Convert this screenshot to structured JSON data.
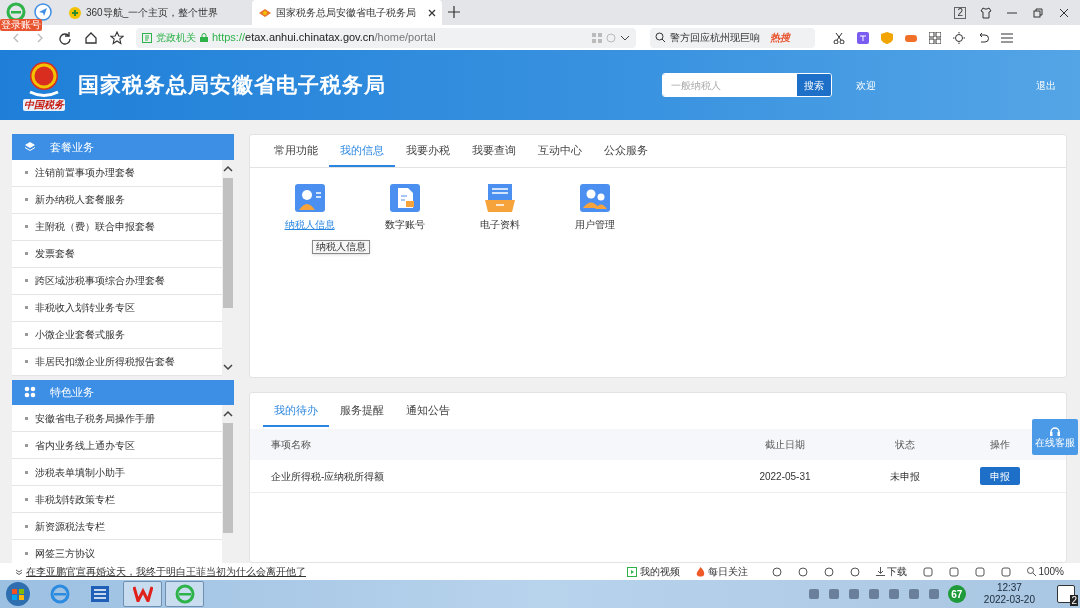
{
  "browser": {
    "login_badge": "登录账号",
    "tabs": [
      {
        "title": "360导航_一个主页，整个世界",
        "selected": false
      },
      {
        "title": "国家税务总局安徽省电子税务局",
        "selected": true
      }
    ],
    "tab_count": "2",
    "address": {
      "badge": "党政机关",
      "scheme": "https://",
      "host": "etax.anhui.chinatax.gov.cn",
      "path": "/home/portal"
    },
    "search": {
      "placeholder": "警方回应杭州现巨响",
      "hot": "热搜"
    }
  },
  "header": {
    "title": "国家税务总局安徽省电子税务局",
    "logo_caption": "中国税务",
    "search": {
      "placeholder": "一般纳税人",
      "button": "搜索"
    },
    "welcome": "欢迎",
    "logout": "退出"
  },
  "sidebar": [
    {
      "title": "套餐业务",
      "items": [
        "注销前置事项办理套餐",
        "新办纳税人套餐服务",
        "主附税（费）联合申报套餐",
        "发票套餐",
        "跨区域涉税事项综合办理套餐",
        "非税收入划转业务专区",
        "小微企业套餐式服务",
        "非居民扣缴企业所得税报告套餐"
      ]
    },
    {
      "title": "特色业务",
      "items": [
        "安徽省电子税务局操作手册",
        "省内业务线上通办专区",
        "涉税表单填制小助手",
        "非税划转政策专栏",
        "新资源税法专栏",
        "网签三方协议"
      ]
    }
  ],
  "top_panel": {
    "tabs": [
      {
        "label": "常用功能",
        "selected": false
      },
      {
        "label": "我的信息",
        "selected": true
      },
      {
        "label": "我要办税",
        "selected": false
      },
      {
        "label": "我要查询",
        "selected": false
      },
      {
        "label": "互动中心",
        "selected": false
      },
      {
        "label": "公众服务",
        "selected": false
      }
    ],
    "apps": [
      {
        "label": "纳税人信息",
        "hovered": true
      },
      {
        "label": "数字账号",
        "hovered": false
      },
      {
        "label": "电子资料",
        "hovered": false
      },
      {
        "label": "用户管理",
        "hovered": false
      }
    ],
    "tooltip": "纳税人信息"
  },
  "bottom_panel": {
    "tabs": [
      {
        "label": "我的待办",
        "selected": true
      },
      {
        "label": "服务提醒",
        "selected": false
      },
      {
        "label": "通知公告",
        "selected": false
      }
    ],
    "columns": [
      "事项名称",
      "截止日期",
      "状态",
      "操作"
    ],
    "rows": [
      {
        "name": "企业所得税-应纳税所得额",
        "deadline": "2022-05-31",
        "status": "未申报",
        "action": "申报"
      }
    ]
  },
  "float_button": "在线客服",
  "status_bar": {
    "news": "在李亚鹏官宣再婚这天，我终于明白王菲当初为什么会离开他了",
    "video": "我的视频",
    "follow": "每日关注",
    "download": "下载",
    "zoom": "100%"
  },
  "taskbar": {
    "badge": "67",
    "time": "12:37",
    "date": "2022-03-20",
    "notifications": "2"
  }
}
